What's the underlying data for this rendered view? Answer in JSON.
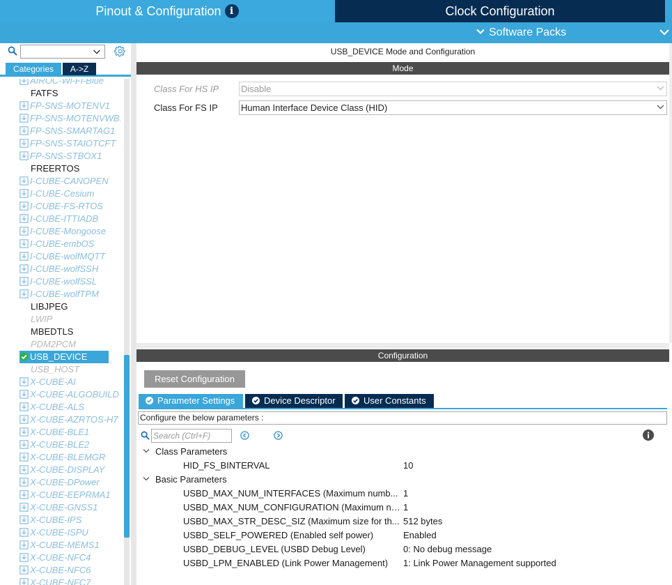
{
  "header": {
    "tab_pinout": "Pinout & Configuration",
    "tab_clock": "Clock Configuration",
    "software_packs": "Software Packs",
    "colors": {
      "header_blue": "#3aa6d9",
      "dark_navy": "#062c52"
    }
  },
  "sidebar": {
    "search_value": "",
    "tab_categories": "Categories",
    "tab_az": "A->Z",
    "items": [
      {
        "label": "AIROC-Wi-Fi-Blue",
        "kind": "pack"
      },
      {
        "label": "FATFS",
        "kind": "plain"
      },
      {
        "label": "FP-SNS-MOTENV1",
        "kind": "pack"
      },
      {
        "label": "FP-SNS-MOTENVWB1",
        "kind": "pack"
      },
      {
        "label": "FP-SNS-SMARTAG1",
        "kind": "pack"
      },
      {
        "label": "FP-SNS-STAIOTCFT",
        "kind": "pack"
      },
      {
        "label": "FP-SNS-STBOX1",
        "kind": "pack"
      },
      {
        "label": "FREERTOS",
        "kind": "plain"
      },
      {
        "label": "I-CUBE-CANOPEN",
        "kind": "pack"
      },
      {
        "label": "I-CUBE-Cesium",
        "kind": "pack"
      },
      {
        "label": "I-CUBE-FS-RTOS",
        "kind": "pack"
      },
      {
        "label": "I-CUBE-ITTIADB",
        "kind": "pack"
      },
      {
        "label": "I-CUBE-Mongoose",
        "kind": "pack"
      },
      {
        "label": "I-CUBE-embOS",
        "kind": "pack"
      },
      {
        "label": "I-CUBE-wolfMQTT",
        "kind": "pack"
      },
      {
        "label": "I-CUBE-wolfSSH",
        "kind": "pack"
      },
      {
        "label": "I-CUBE-wolfSSL",
        "kind": "pack"
      },
      {
        "label": "I-CUBE-wolfTPM",
        "kind": "pack"
      },
      {
        "label": "LIBJPEG",
        "kind": "plain"
      },
      {
        "label": "LWIP",
        "kind": "disabled"
      },
      {
        "label": "MBEDTLS",
        "kind": "plain"
      },
      {
        "label": "PDM2PCM",
        "kind": "disabled"
      },
      {
        "label": "USB_DEVICE",
        "kind": "selected"
      },
      {
        "label": "USB_HOST",
        "kind": "disabled"
      },
      {
        "label": "X-CUBE-AI",
        "kind": "pack"
      },
      {
        "label": "X-CUBE-ALGOBUILD",
        "kind": "pack"
      },
      {
        "label": "X-CUBE-ALS",
        "kind": "pack"
      },
      {
        "label": "X-CUBE-AZRTOS-H7",
        "kind": "pack"
      },
      {
        "label": "X-CUBE-BLE1",
        "kind": "pack"
      },
      {
        "label": "X-CUBE-BLE2",
        "kind": "pack"
      },
      {
        "label": "X-CUBE-BLEMGR",
        "kind": "pack"
      },
      {
        "label": "X-CUBE-DISPLAY",
        "kind": "pack"
      },
      {
        "label": "X-CUBE-DPower",
        "kind": "pack"
      },
      {
        "label": "X-CUBE-EEPRMA1",
        "kind": "pack"
      },
      {
        "label": "X-CUBE-GNSS1",
        "kind": "pack"
      },
      {
        "label": "X-CUBE-IPS",
        "kind": "pack"
      },
      {
        "label": "X-CUBE-ISPU",
        "kind": "pack"
      },
      {
        "label": "X-CUBE-MEMS1",
        "kind": "pack"
      },
      {
        "label": "X-CUBE-NFC4",
        "kind": "pack"
      },
      {
        "label": "X-CUBE-NFC6",
        "kind": "pack"
      },
      {
        "label": "X-CUBE-NFC7",
        "kind": "pack"
      }
    ]
  },
  "main": {
    "title": "USB_DEVICE Mode and Configuration",
    "mode_header": "Mode",
    "hs_label": "Class For HS IP",
    "hs_value": "Disable",
    "fs_label": "Class For FS IP",
    "fs_value": "Human Interface Device Class (HID)",
    "config_header": "Configuration",
    "reset_button": "Reset Configuration",
    "tabs": [
      "Parameter Settings",
      "Device Descriptor",
      "User Constants"
    ],
    "hint": "Configure the below parameters :",
    "search_placeholder": "Search (Ctrl+F)",
    "groups": [
      {
        "name": "Class Parameters",
        "params": [
          {
            "name": "HID_FS_BINTERVAL",
            "value": "10"
          }
        ]
      },
      {
        "name": "Basic Parameters",
        "params": [
          {
            "name": "USBD_MAX_NUM_INTERFACES (Maximum numb...",
            "value": "1"
          },
          {
            "name": "USBD_MAX_NUM_CONFIGURATION (Maximum nu...",
            "value": "1"
          },
          {
            "name": "USBD_MAX_STR_DESC_SIZ (Maximum size for th...",
            "value": "512 bytes"
          },
          {
            "name": "USBD_SELF_POWERED (Enabled self power)",
            "value": "Enabled"
          },
          {
            "name": "USBD_DEBUG_LEVEL (USBD Debug Level)",
            "value": "0: No debug message"
          },
          {
            "name": "USBD_LPM_ENABLED (Link Power Management)",
            "value": "1: Link Power Management supported"
          }
        ]
      }
    ]
  }
}
